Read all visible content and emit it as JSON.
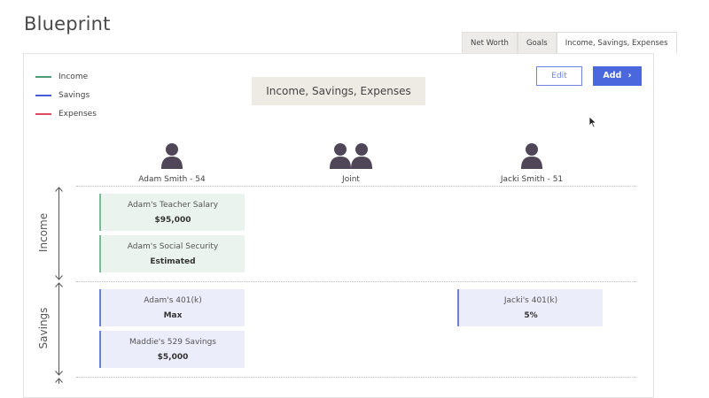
{
  "header": {
    "title": "Blueprint"
  },
  "tabs": [
    {
      "label": "Net Worth",
      "active": false
    },
    {
      "label": "Goals",
      "active": false
    },
    {
      "label": "Income, Savings, Expenses",
      "active": true
    }
  ],
  "legend": [
    {
      "label": "Income",
      "color": "#4f9b74"
    },
    {
      "label": "Savings",
      "color": "#4a5ad6"
    },
    {
      "label": "Expenses",
      "color": "#e04a60"
    }
  ],
  "section_title": "Income, Savings, Expenses",
  "actions": {
    "edit_label": "Edit",
    "add_label": "Add",
    "add_icon": "chevron-right-icon"
  },
  "people": [
    {
      "label": "Adam Smith - 54",
      "icon": "person-icon"
    },
    {
      "label": "Joint",
      "icon": "people-icon"
    },
    {
      "label": "Jacki Smith - 51",
      "icon": "person-icon"
    }
  ],
  "rows": {
    "income": {
      "label": "Income",
      "cards": [
        {
          "name": "Adam's Teacher Salary",
          "value": "$95,000"
        },
        {
          "name": "Adam's Social Security",
          "value": "Estimated"
        }
      ]
    },
    "savings": {
      "label": "Savings",
      "cards": [
        {
          "name": "Adam's 401(k)",
          "value": "Max"
        },
        {
          "name": "Maddie's 529 Savings",
          "value": "$5,000"
        },
        {
          "name": "Jacki's 401(k)",
          "value": "5%"
        }
      ]
    }
  }
}
